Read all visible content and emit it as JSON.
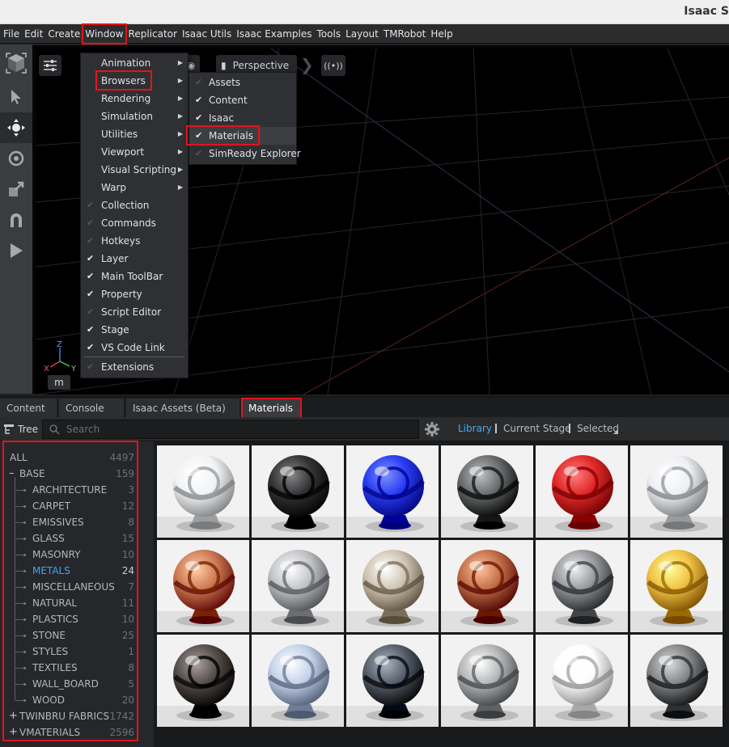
{
  "window": {
    "title": "Isaac S"
  },
  "menubar": {
    "items": [
      "File",
      "Edit",
      "Create",
      "Window",
      "Replicator",
      "Isaac Utils",
      "Isaac Examples",
      "Tools",
      "Layout",
      "TMRobot",
      "Help"
    ]
  },
  "viewport": {
    "axes": {
      "x": "X",
      "y": "Y",
      "z": "Z"
    },
    "units_button": "m",
    "toolbar_partial_label": "Perspective"
  },
  "window_menu": {
    "items": [
      {
        "label": "Animation",
        "submenu": true
      },
      {
        "label": "Browsers",
        "submenu": true
      },
      {
        "label": "Rendering",
        "submenu": true
      },
      {
        "label": "Simulation",
        "submenu": true
      },
      {
        "label": "Utilities",
        "submenu": true
      },
      {
        "label": "Viewport",
        "submenu": true
      },
      {
        "label": "Visual Scripting",
        "submenu": true
      },
      {
        "label": "Warp",
        "submenu": true
      },
      {
        "label": "Collection",
        "checked": false
      },
      {
        "label": "Commands",
        "checked": false
      },
      {
        "label": "Hotkeys",
        "checked": false
      },
      {
        "label": "Layer",
        "checked": true
      },
      {
        "label": "Main ToolBar",
        "checked": true
      },
      {
        "label": "Property",
        "checked": true
      },
      {
        "label": "Script Editor",
        "checked": false
      },
      {
        "label": "Stage",
        "checked": true
      },
      {
        "label": "VS Code Link",
        "checked": true
      },
      {
        "label": "Extensions",
        "checked": false
      }
    ]
  },
  "browsers_menu": {
    "items": [
      {
        "label": "Assets",
        "checked": false
      },
      {
        "label": "Content",
        "checked": true
      },
      {
        "label": "Isaac",
        "checked": true
      },
      {
        "label": "Materials",
        "checked": true
      },
      {
        "label": "SimReady Explorer",
        "checked": false
      }
    ]
  },
  "tabs": [
    "Content",
    "Console",
    "Isaac Assets (Beta)",
    "Materials"
  ],
  "materials_toolbar": {
    "tree_label": "Tree",
    "search_placeholder": "Search",
    "filters": [
      "Library",
      "Current Stage",
      "Selected"
    ]
  },
  "tree": {
    "all": {
      "label": "ALL",
      "count": "4497"
    },
    "base": {
      "label": "BASE",
      "count": "159"
    },
    "children": [
      {
        "label": "ARCHITECTURE",
        "count": "3"
      },
      {
        "label": "CARPET",
        "count": "12"
      },
      {
        "label": "EMISSIVES",
        "count": "8"
      },
      {
        "label": "GLASS",
        "count": "15"
      },
      {
        "label": "MASONRY",
        "count": "10"
      },
      {
        "label": "METALS",
        "count": "24",
        "selected": true
      },
      {
        "label": "MISCELLANEOUS",
        "count": "7"
      },
      {
        "label": "NATURAL",
        "count": "11"
      },
      {
        "label": "PLASTICS",
        "count": "10"
      },
      {
        "label": "STONE",
        "count": "25"
      },
      {
        "label": "STYLES",
        "count": "1"
      },
      {
        "label": "TEXTILES",
        "count": "8"
      },
      {
        "label": "WALL_BOARD",
        "count": "5"
      },
      {
        "label": "WOOD",
        "count": "20"
      }
    ],
    "twinbru": {
      "label": "TWINBRU FABRICS",
      "count": "1742"
    },
    "vmaterials": {
      "label": "VMATERIALS",
      "count": "2596"
    }
  },
  "thumbnails": {
    "rows": [
      [
        "#d8dadc",
        "#1a1a1c",
        "#1024d8",
        "#505254",
        "#c81010",
        "#d4d6da"
      ],
      [
        "#b4603a",
        "#a8aaae",
        "#b6aa98",
        "#a8542e",
        "#7e8084",
        "#d6a82a"
      ],
      [
        "#3c3430",
        "#aab8d0",
        "#3e4652",
        "#9a9c9e",
        "#e4e4e4",
        "#6a6c6e"
      ]
    ]
  }
}
